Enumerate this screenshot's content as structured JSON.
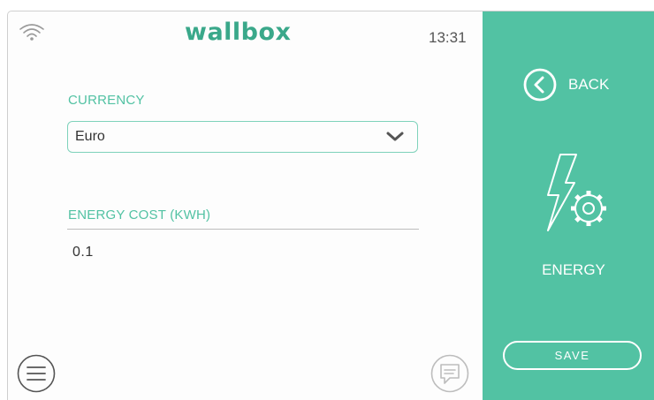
{
  "header": {
    "logo_text": "wallbox",
    "time": "13:31",
    "wifi_icon": "wifi-icon"
  },
  "form": {
    "currency": {
      "label": "CURRENCY",
      "selected": "Euro"
    },
    "energy_cost": {
      "label": "ENERGY COST (KWH)",
      "value": "0.1"
    }
  },
  "sidebar": {
    "back_label": "BACK",
    "section_title": "ENERGY",
    "save_label": "SAVE"
  },
  "colors": {
    "accent": "#52c2a3",
    "logo": "#3aa88a"
  }
}
